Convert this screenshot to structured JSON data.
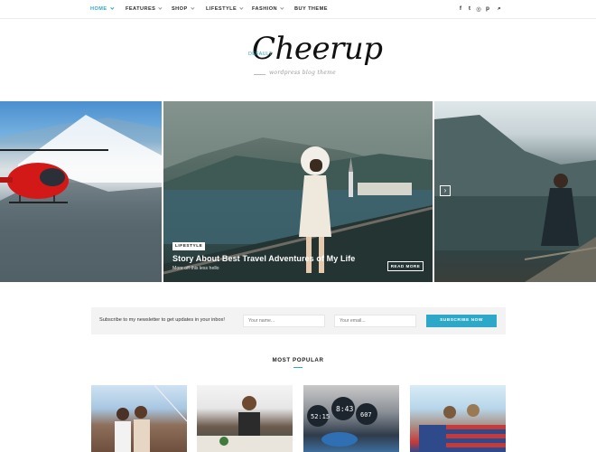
{
  "nav": {
    "items": [
      {
        "label": "HOME",
        "active": true
      },
      {
        "label": "FEATURES",
        "active": false
      },
      {
        "label": "SHOP",
        "active": false
      },
      {
        "label": "LIFESTYLE",
        "active": false
      },
      {
        "label": "FASHION",
        "active": false
      },
      {
        "label": "BUY THEME",
        "active": false
      }
    ],
    "social_icons": [
      "facebook-icon",
      "twitter-icon",
      "instagram-icon",
      "pinterest-icon",
      "search-icon"
    ],
    "social_glyphs": [
      "f",
      "t",
      "◎",
      "p",
      "⌕"
    ]
  },
  "logo": {
    "title": "Cheerup",
    "badge": "DEFAULT",
    "tagline": "wordpress blog theme"
  },
  "slider": {
    "category": "LIFESTYLE",
    "title": "Story About Best Travel Adventures of My Life",
    "excerpt": "More off this less hello",
    "read_more": "READ MORE",
    "next_arrow": "›"
  },
  "newsletter": {
    "text": "Subscribe to my newsletter to get updates in your inbox!",
    "name_placeholder": "Your name...",
    "email_placeholder": "Your email...",
    "button": "SUBSCRIBE NOW"
  },
  "popular": {
    "title": "MOST POPULAR"
  },
  "colors": {
    "accent": "#2ea8c9",
    "newsletter_bg": "#f3f3f3"
  }
}
